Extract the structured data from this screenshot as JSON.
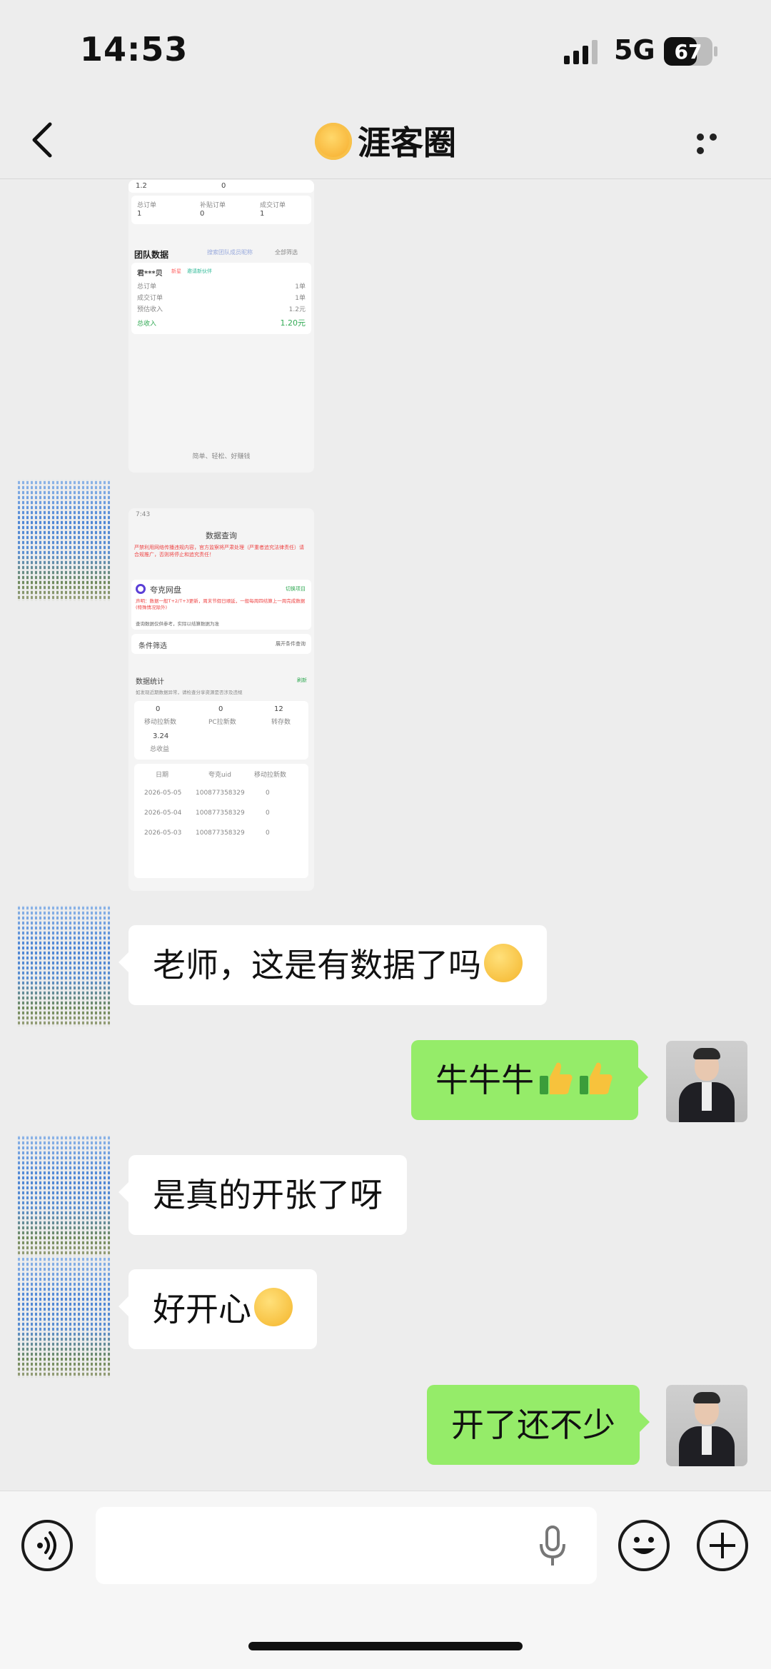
{
  "status": {
    "time": "14:53",
    "network": "5G",
    "battery": "67"
  },
  "nav": {
    "title": "涯客圈",
    "title_icon": "sun-emoji-icon"
  },
  "screenshot1": {
    "top_value_a": "1.2",
    "top_value_b": "0",
    "stats": [
      {
        "label": "总订单",
        "value": "1"
      },
      {
        "label": "补贴订单",
        "value": "0"
      },
      {
        "label": "成交订单",
        "value": "1"
      }
    ],
    "section_title": "团队数据",
    "search_placeholder": "搜索团队成员昵称",
    "filter_label": "全部筛选",
    "member": {
      "name": "君***贝",
      "tag_a": "新星",
      "tag_b": "邀请新伙伴",
      "rows": [
        {
          "label": "总订单",
          "value": "1单"
        },
        {
          "label": "成交订单",
          "value": "1单"
        },
        {
          "label": "预估收入",
          "value": "1.2元"
        },
        {
          "label": "总收入",
          "value": "1.20元"
        }
      ]
    },
    "footer": "简单、轻松、好赚钱"
  },
  "screenshot2": {
    "status_time": "7:43",
    "page_title": "数据查询",
    "warning": "严禁利用网络传播违规内容，官方监察将严肃处理（严重者追究法律责任）请合规推广，否则将停止和追究责任！",
    "app_name": "夸克网盘",
    "switch_label": "切换项目",
    "notice": "声明：数据一般T+2/T+3更新，周末节假日顺延，一般每周四结算上一周完成数据(特殊情况除外)",
    "notice2": "查询数据仅供参考，实际以结算数据为准",
    "filter_label": "条件筛选",
    "filter_value": "展开条件查询",
    "stats_title": "数据统计",
    "refresh_label": "刷新",
    "stats_hint": "如发现近期数据异常，请检查分享资源是否涉及违规",
    "metrics": [
      {
        "value": "0",
        "label": "移动拉新数"
      },
      {
        "value": "0",
        "label": "PC拉新数"
      },
      {
        "value": "12",
        "label": "转存数"
      },
      {
        "value": "3.24",
        "label": "总收益"
      }
    ],
    "table_headers": [
      "日期",
      "夸克uid",
      "移动拉新数"
    ],
    "table_rows": [
      [
        "2026-05-05",
        "100877358329",
        "0"
      ],
      [
        "2026-05-04",
        "100877358329",
        "0"
      ],
      [
        "2026-05-03",
        "100877358329",
        "0"
      ]
    ]
  },
  "messages": [
    {
      "side": "left",
      "text": "老师，这是有数据了吗",
      "emoji": "thinking-face-icon"
    },
    {
      "side": "right",
      "text": "牛牛牛",
      "emoji": "thumbs-up-icon"
    },
    {
      "side": "left",
      "text": "是真的开张了呀"
    },
    {
      "side": "left",
      "text": "好开心",
      "emoji": "heart-eyes-face-icon"
    },
    {
      "side": "right",
      "text": "开了还不少"
    }
  ],
  "colors": {
    "background": "#ededed",
    "bubble_right": "#95ec69",
    "bubble_left": "#ffffff",
    "accent_green": "#07c160"
  }
}
